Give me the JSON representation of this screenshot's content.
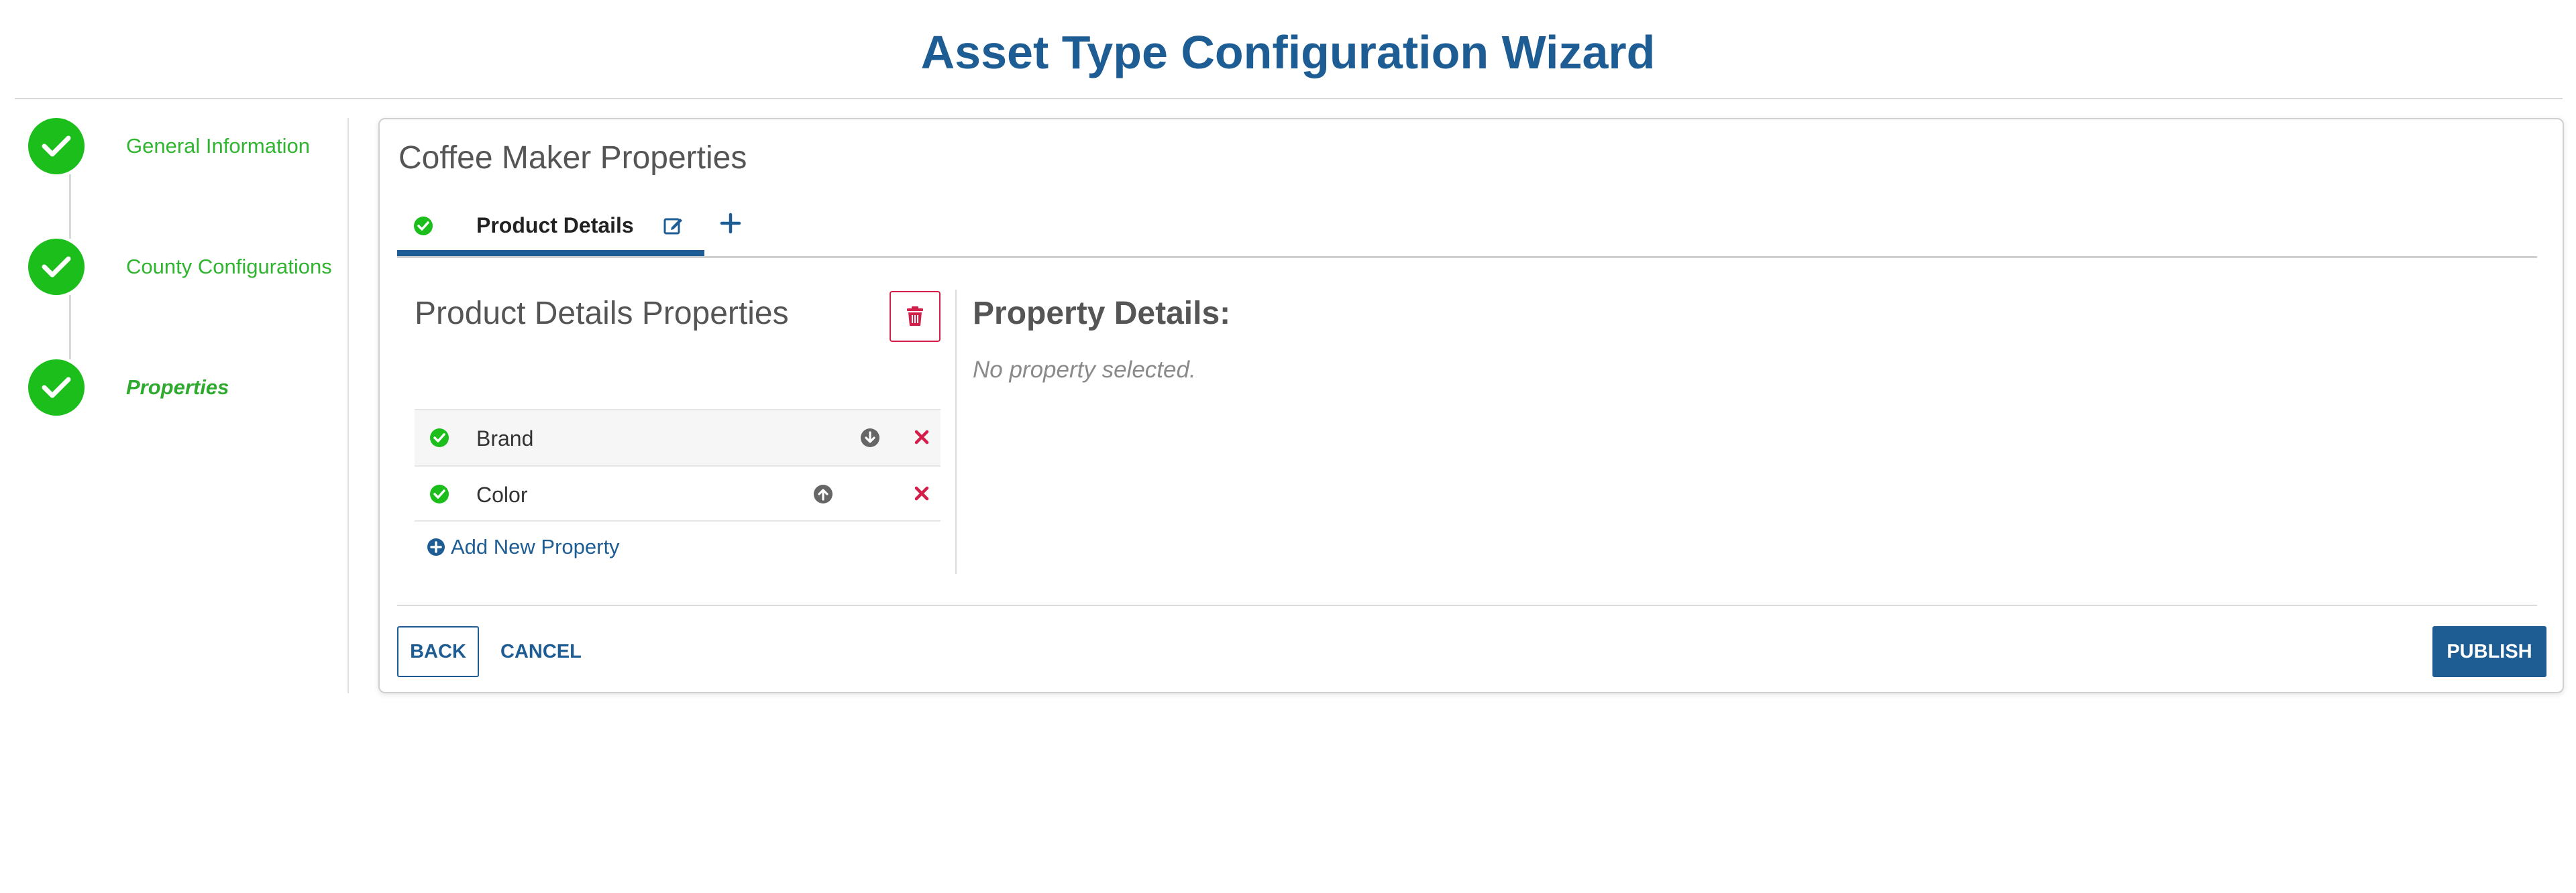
{
  "page": {
    "title": "Asset Type Configuration Wizard"
  },
  "steps": [
    {
      "label": "General Information",
      "status": "complete"
    },
    {
      "label": "County Configurations",
      "status": "complete"
    },
    {
      "label": "Properties",
      "status": "complete",
      "active": true
    }
  ],
  "card": {
    "title": "Coffee Maker Properties",
    "tabs": [
      {
        "label": "Product Details",
        "active": true
      }
    ]
  },
  "properties_panel": {
    "title": "Product Details Properties",
    "items": [
      {
        "name": "Brand"
      },
      {
        "name": "Color"
      }
    ],
    "add_label": "Add New Property"
  },
  "details_panel": {
    "title": "Property Details:",
    "empty_text": "No property selected."
  },
  "footer": {
    "back_label": "BACK",
    "cancel_label": "CANCEL",
    "publish_label": "PUBLISH"
  },
  "colors": {
    "primary": "#1e5d94",
    "success": "#1cbe1c",
    "danger": "#d41e4a",
    "muted": "#8a8a8a"
  }
}
